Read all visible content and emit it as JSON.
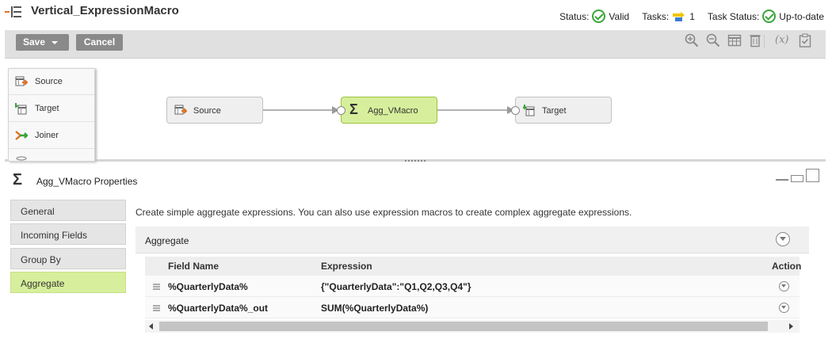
{
  "header": {
    "title": "Vertical_ExpressionMacro",
    "status_label": "Status:",
    "status_value": "Valid",
    "tasks_label": "Tasks:",
    "tasks_count": "1",
    "task_status_label": "Task Status:",
    "task_status_value": "Up-to-date"
  },
  "toolbar": {
    "save_label": "Save",
    "cancel_label": "Cancel",
    "icons": [
      "zoom-in-icon",
      "zoom-out-icon",
      "grid-icon",
      "delete-icon",
      "function-icon",
      "validate-icon"
    ],
    "function_label": "(x)"
  },
  "palette": {
    "items": [
      {
        "label": "Source",
        "icon": "source-icon"
      },
      {
        "label": "Target",
        "icon": "target-icon"
      },
      {
        "label": "Joiner",
        "icon": "joiner-icon"
      }
    ]
  },
  "mapping": {
    "nodes": [
      {
        "label": "Source",
        "icon": "source-icon"
      },
      {
        "label": "Agg_VMacro",
        "icon": "sigma-icon"
      },
      {
        "label": "Target",
        "icon": "target-icon"
      }
    ],
    "colors": {
      "selected_node": "#d7ef9c",
      "node": "#efefef"
    }
  },
  "properties": {
    "title": "Agg_VMacro Properties",
    "tabs": [
      {
        "label": "General"
      },
      {
        "label": "Incoming Fields"
      },
      {
        "label": "Group By"
      },
      {
        "label": "Aggregate",
        "active": true
      }
    ],
    "description": "Create simple aggregate expressions. You can also use expression macros to create complex aggregate expressions.",
    "aggregate": {
      "title": "Aggregate",
      "columns": {
        "field_name": "Field Name",
        "expression": "Expression",
        "action": "Action"
      },
      "rows": [
        {
          "field_name": "%QuarterlyData%",
          "expression": "{\"QuarterlyData\":\"Q1,Q2,Q3,Q4\"}"
        },
        {
          "field_name": "%QuarterlyData%_out",
          "expression": "SUM(%QuarterlyData%)"
        }
      ]
    }
  },
  "colors": {
    "accent_green": "#3aa53a",
    "active_tab": "#d7ef9c",
    "button_gray": "#8a8a8a"
  }
}
